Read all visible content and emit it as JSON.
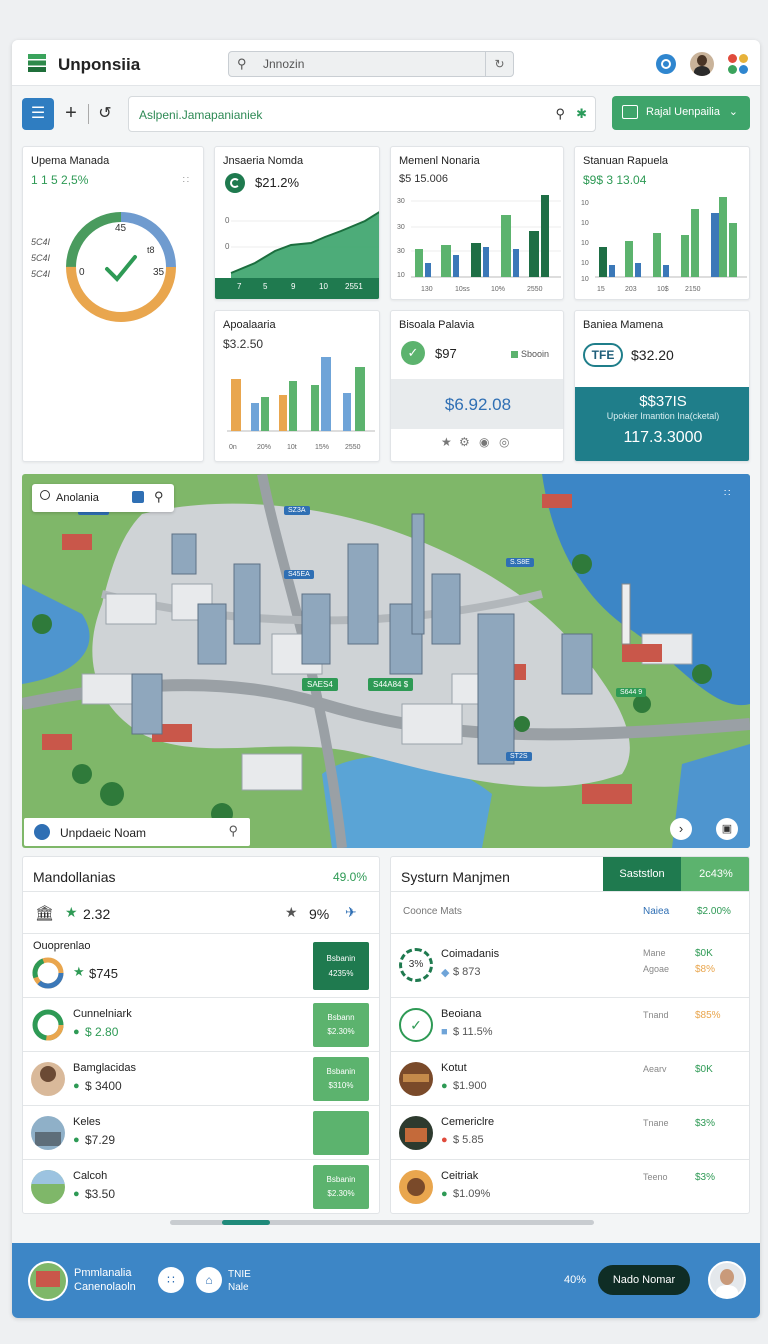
{
  "header": {
    "app_name": "Unponsiia",
    "search_value": "Jnnozin"
  },
  "toolbar": {
    "address_value": "Aslpeni.Jamapanianiek",
    "region_button": "Rajal Uenpailia"
  },
  "cards": {
    "c1": {
      "title": "Upema Manada",
      "value": "1 1 5 2,5%",
      "labels": [
        "5C4I",
        "5C4I",
        "5C4I"
      ],
      "gauge_labels": [
        "45",
        "0",
        "35",
        "t8"
      ]
    },
    "c2": {
      "title": "Jnsaeria Nomda",
      "value": "$21.2%",
      "y_ticks": [
        "0",
        "0"
      ],
      "x_ticks": [
        "7",
        "5",
        "9",
        "10",
        "2551"
      ]
    },
    "c3": {
      "title": "Memenl Nonaria",
      "value": "$5 15.006",
      "y_ticks": [
        "30",
        "30",
        "30",
        "10"
      ],
      "x_ticks": [
        "130",
        "10ss",
        "10%",
        "2550"
      ]
    },
    "c4": {
      "title": "Stanuan Rapuela",
      "value": "$9$ 3 13.04",
      "y_ticks": [
        "10",
        "10",
        "10",
        "10",
        "10"
      ],
      "x_ticks": [
        "15",
        "203",
        "10$",
        "2150"
      ]
    },
    "c5": {
      "title": "Apoalaaria",
      "value": "$3.2.50",
      "x_ticks": [
        "0n",
        "20%",
        "10t",
        "15%",
        "2550"
      ]
    },
    "c6": {
      "title": "Bisoala Palavia",
      "value": "$97",
      "legend": "Sbooin",
      "amount": "$6.92.08"
    },
    "c7": {
      "title": "Baniea Mamena",
      "badge": "TFE",
      "value": "$32.20",
      "banner_value": "$$37IS",
      "banner_sub": "Upokier Imantion Ina(cketal)",
      "banner_total": "117.3.3000"
    }
  },
  "map": {
    "search_label": "Anolania",
    "footer_label": "Unpdaeic Noam",
    "pins": [
      "SZ3A",
      "S45EA",
      "S.S8E",
      "SAES4",
      "S44A84 $",
      "S644 9",
      "ST2S",
      "SSAS4"
    ]
  },
  "left_panel": {
    "title": "Mandollanias",
    "percent": "49.0%",
    "rating": "2.32",
    "score": "9%",
    "list_title": "Ouoprenlao",
    "rows": [
      {
        "name": "Ouoprenlao",
        "value": "$745",
        "btn1": "Bsbanin",
        "btn2": "4235%"
      },
      {
        "name": "Cunnelniark",
        "value": "$ 2.80",
        "btn1": "Bsbann",
        "btn2": "$2.30%"
      },
      {
        "name": "Bamglacidas",
        "value": "$ 3400",
        "btn1": "Bsbanin",
        "btn2": "$310%"
      },
      {
        "name": "Keles",
        "value": "$7.29",
        "btn1": "",
        "btn2": ""
      },
      {
        "name": "Calcoh",
        "value": "$3.50",
        "btn1": "Bsbanin",
        "btn2": "$2.30%"
      }
    ]
  },
  "right_panel": {
    "title": "Systurn Manjmen",
    "tab_active": "Saststlon",
    "tab_other": "2c43%",
    "sub_left": "Coonce Mats",
    "sub_mid": "Naiea",
    "sub_right": "$2.00%",
    "rows": [
      {
        "name": "Coimadanis",
        "value": "$ 873",
        "icon_text": "3%",
        "label": "Mane",
        "label2": "Agoae",
        "v1": "$0K",
        "v2": "$8%"
      },
      {
        "name": "Beoiana",
        "value": "$ 11.5%",
        "label": "Tnand",
        "v1": "$85%"
      },
      {
        "name": "Kotut",
        "value": "$1.900",
        "label": "Aearv",
        "v1": "$0K"
      },
      {
        "name": "Cemericlre",
        "value": "$ 5.85",
        "label": "Tnane",
        "v1": "$3%"
      },
      {
        "name": "Ceitriak",
        "value": "$1.09%",
        "label": "Teeno",
        "v1": "$3%"
      }
    ]
  },
  "footer": {
    "name1": "Pmmlanalia",
    "name2": "Canenolaoln",
    "mid1": "TNIE",
    "mid2": "Nale",
    "right_text": "40%",
    "button": "Nado Nomar"
  }
}
